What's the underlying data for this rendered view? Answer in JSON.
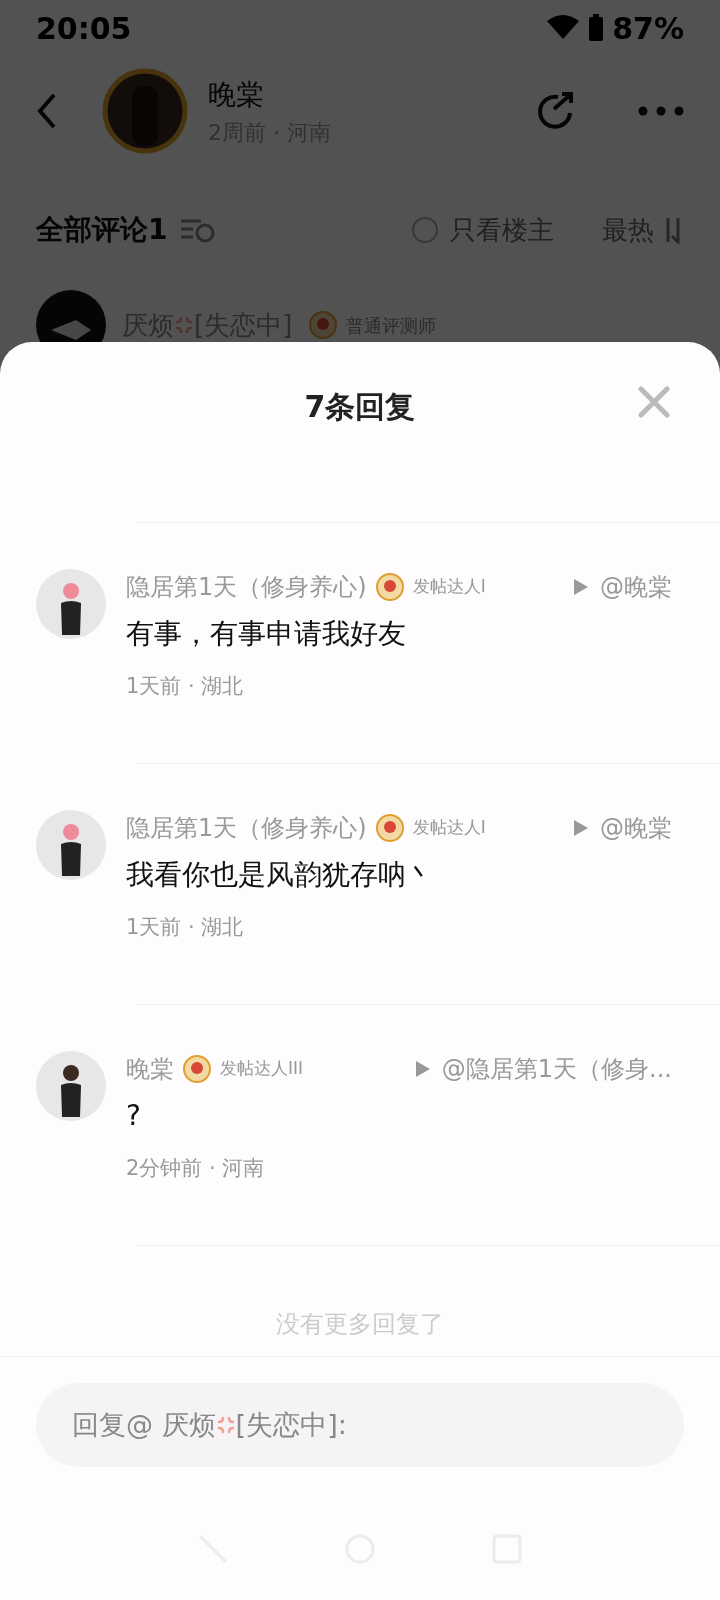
{
  "status_bar": {
    "time": "20:05",
    "battery": "87%"
  },
  "post_header": {
    "author": "晚棠",
    "meta": "2周前 · 河南"
  },
  "comments_bar": {
    "title": "全部评论1",
    "only_op": {
      "label": "只看楼主",
      "checked": false
    },
    "sort": "最热"
  },
  "background_comment": {
    "user": "厌烦",
    "user_suffix": "[失恋中]",
    "badge": "普通评测师"
  },
  "sheet": {
    "title": "7条回复"
  },
  "replies": [
    {
      "user": "隐居第1天（修身养心)",
      "badge": "发帖达人I",
      "reply_to": "@晚棠",
      "text": "有事，有事申请我好友",
      "meta": "1天前 · 湖北"
    },
    {
      "user": "隐居第1天（修身养心)",
      "badge": "发帖达人I",
      "reply_to": "@晚棠",
      "text": "我看你也是风韵犹存呐丶",
      "meta": "1天前 · 湖北"
    },
    {
      "user": "晚棠",
      "badge": "发帖达人III",
      "reply_to": "@隐居第1天（修身...",
      "text": "?",
      "meta": "2分钟前 · 河南"
    }
  ],
  "end_note": "没有更多回复了",
  "reply_input": {
    "placeholder_prefix": "回复@ 厌烦",
    "placeholder_suffix": "[失恋中]:"
  }
}
